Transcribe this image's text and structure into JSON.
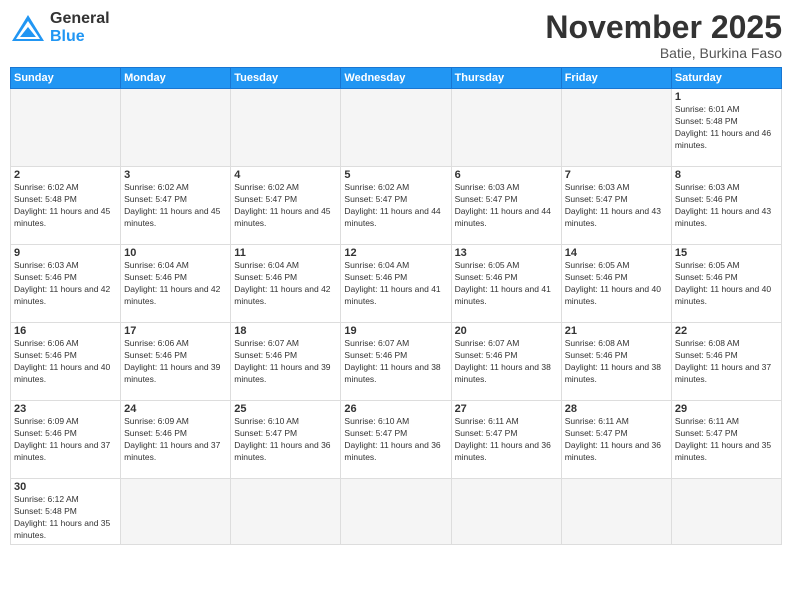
{
  "header": {
    "logo_general": "General",
    "logo_blue": "Blue",
    "month_title": "November 2025",
    "location": "Batie, Burkina Faso"
  },
  "days_of_week": [
    "Sunday",
    "Monday",
    "Tuesday",
    "Wednesday",
    "Thursday",
    "Friday",
    "Saturday"
  ],
  "weeks": [
    [
      {
        "day": "",
        "empty": true
      },
      {
        "day": "",
        "empty": true
      },
      {
        "day": "",
        "empty": true
      },
      {
        "day": "",
        "empty": true
      },
      {
        "day": "",
        "empty": true
      },
      {
        "day": "",
        "empty": true
      },
      {
        "day": "1",
        "sunrise": "Sunrise: 6:01 AM",
        "sunset": "Sunset: 5:48 PM",
        "daylight": "Daylight: 11 hours and 46 minutes."
      }
    ],
    [
      {
        "day": "2",
        "sunrise": "Sunrise: 6:02 AM",
        "sunset": "Sunset: 5:48 PM",
        "daylight": "Daylight: 11 hours and 45 minutes."
      },
      {
        "day": "3",
        "sunrise": "Sunrise: 6:02 AM",
        "sunset": "Sunset: 5:47 PM",
        "daylight": "Daylight: 11 hours and 45 minutes."
      },
      {
        "day": "4",
        "sunrise": "Sunrise: 6:02 AM",
        "sunset": "Sunset: 5:47 PM",
        "daylight": "Daylight: 11 hours and 45 minutes."
      },
      {
        "day": "5",
        "sunrise": "Sunrise: 6:02 AM",
        "sunset": "Sunset: 5:47 PM",
        "daylight": "Daylight: 11 hours and 44 minutes."
      },
      {
        "day": "6",
        "sunrise": "Sunrise: 6:03 AM",
        "sunset": "Sunset: 5:47 PM",
        "daylight": "Daylight: 11 hours and 44 minutes."
      },
      {
        "day": "7",
        "sunrise": "Sunrise: 6:03 AM",
        "sunset": "Sunset: 5:47 PM",
        "daylight": "Daylight: 11 hours and 43 minutes."
      },
      {
        "day": "8",
        "sunrise": "Sunrise: 6:03 AM",
        "sunset": "Sunset: 5:46 PM",
        "daylight": "Daylight: 11 hours and 43 minutes."
      }
    ],
    [
      {
        "day": "9",
        "sunrise": "Sunrise: 6:03 AM",
        "sunset": "Sunset: 5:46 PM",
        "daylight": "Daylight: 11 hours and 42 minutes."
      },
      {
        "day": "10",
        "sunrise": "Sunrise: 6:04 AM",
        "sunset": "Sunset: 5:46 PM",
        "daylight": "Daylight: 11 hours and 42 minutes."
      },
      {
        "day": "11",
        "sunrise": "Sunrise: 6:04 AM",
        "sunset": "Sunset: 5:46 PM",
        "daylight": "Daylight: 11 hours and 42 minutes."
      },
      {
        "day": "12",
        "sunrise": "Sunrise: 6:04 AM",
        "sunset": "Sunset: 5:46 PM",
        "daylight": "Daylight: 11 hours and 41 minutes."
      },
      {
        "day": "13",
        "sunrise": "Sunrise: 6:05 AM",
        "sunset": "Sunset: 5:46 PM",
        "daylight": "Daylight: 11 hours and 41 minutes."
      },
      {
        "day": "14",
        "sunrise": "Sunrise: 6:05 AM",
        "sunset": "Sunset: 5:46 PM",
        "daylight": "Daylight: 11 hours and 40 minutes."
      },
      {
        "day": "15",
        "sunrise": "Sunrise: 6:05 AM",
        "sunset": "Sunset: 5:46 PM",
        "daylight": "Daylight: 11 hours and 40 minutes."
      }
    ],
    [
      {
        "day": "16",
        "sunrise": "Sunrise: 6:06 AM",
        "sunset": "Sunset: 5:46 PM",
        "daylight": "Daylight: 11 hours and 40 minutes."
      },
      {
        "day": "17",
        "sunrise": "Sunrise: 6:06 AM",
        "sunset": "Sunset: 5:46 PM",
        "daylight": "Daylight: 11 hours and 39 minutes."
      },
      {
        "day": "18",
        "sunrise": "Sunrise: 6:07 AM",
        "sunset": "Sunset: 5:46 PM",
        "daylight": "Daylight: 11 hours and 39 minutes."
      },
      {
        "day": "19",
        "sunrise": "Sunrise: 6:07 AM",
        "sunset": "Sunset: 5:46 PM",
        "daylight": "Daylight: 11 hours and 38 minutes."
      },
      {
        "day": "20",
        "sunrise": "Sunrise: 6:07 AM",
        "sunset": "Sunset: 5:46 PM",
        "daylight": "Daylight: 11 hours and 38 minutes."
      },
      {
        "day": "21",
        "sunrise": "Sunrise: 6:08 AM",
        "sunset": "Sunset: 5:46 PM",
        "daylight": "Daylight: 11 hours and 38 minutes."
      },
      {
        "day": "22",
        "sunrise": "Sunrise: 6:08 AM",
        "sunset": "Sunset: 5:46 PM",
        "daylight": "Daylight: 11 hours and 37 minutes."
      }
    ],
    [
      {
        "day": "23",
        "sunrise": "Sunrise: 6:09 AM",
        "sunset": "Sunset: 5:46 PM",
        "daylight": "Daylight: 11 hours and 37 minutes."
      },
      {
        "day": "24",
        "sunrise": "Sunrise: 6:09 AM",
        "sunset": "Sunset: 5:46 PM",
        "daylight": "Daylight: 11 hours and 37 minutes."
      },
      {
        "day": "25",
        "sunrise": "Sunrise: 6:10 AM",
        "sunset": "Sunset: 5:47 PM",
        "daylight": "Daylight: 11 hours and 36 minutes."
      },
      {
        "day": "26",
        "sunrise": "Sunrise: 6:10 AM",
        "sunset": "Sunset: 5:47 PM",
        "daylight": "Daylight: 11 hours and 36 minutes."
      },
      {
        "day": "27",
        "sunrise": "Sunrise: 6:11 AM",
        "sunset": "Sunset: 5:47 PM",
        "daylight": "Daylight: 11 hours and 36 minutes."
      },
      {
        "day": "28",
        "sunrise": "Sunrise: 6:11 AM",
        "sunset": "Sunset: 5:47 PM",
        "daylight": "Daylight: 11 hours and 36 minutes."
      },
      {
        "day": "29",
        "sunrise": "Sunrise: 6:11 AM",
        "sunset": "Sunset: 5:47 PM",
        "daylight": "Daylight: 11 hours and 35 minutes."
      }
    ],
    [
      {
        "day": "30",
        "sunrise": "Sunrise: 6:12 AM",
        "sunset": "Sunset: 5:48 PM",
        "daylight": "Daylight: 11 hours and 35 minutes."
      },
      {
        "day": "",
        "empty": true
      },
      {
        "day": "",
        "empty": true
      },
      {
        "day": "",
        "empty": true
      },
      {
        "day": "",
        "empty": true
      },
      {
        "day": "",
        "empty": true
      },
      {
        "day": "",
        "empty": true
      }
    ]
  ]
}
